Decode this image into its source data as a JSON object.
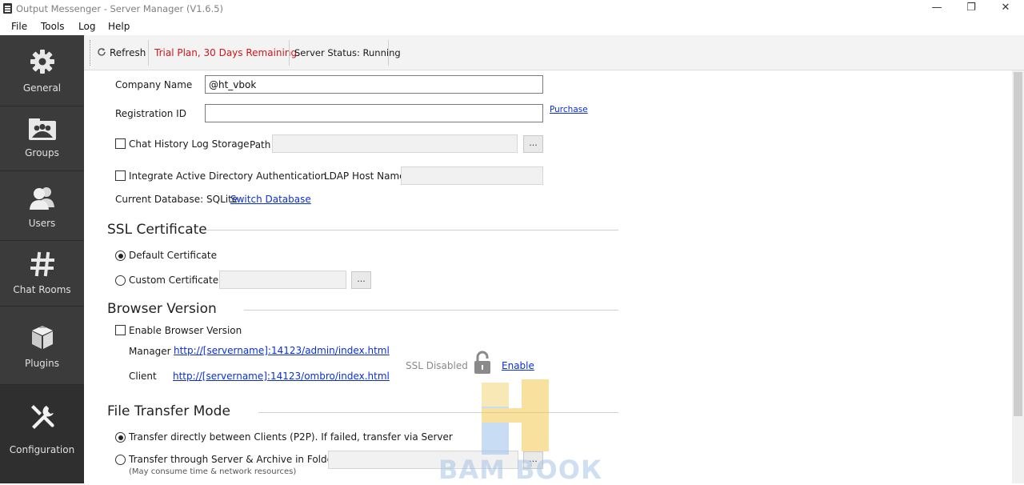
{
  "window": {
    "title": "Output Messenger - Server Manager  (V1.6.5)",
    "minimize": "—",
    "restore": "❐",
    "close": "✕"
  },
  "menu": [
    "File",
    "Tools",
    "Log",
    "Help"
  ],
  "sidebar": {
    "items": [
      {
        "label": "General",
        "icon": "gear-icon"
      },
      {
        "label": "Groups",
        "icon": "groups-icon"
      },
      {
        "label": "Users",
        "icon": "users-icon"
      },
      {
        "label": "Chat Rooms",
        "icon": "hash-icon"
      },
      {
        "label": "Plugins",
        "icon": "plugins-icon"
      },
      {
        "label": "Configuration",
        "icon": "tools-icon"
      }
    ],
    "active": "Configuration"
  },
  "toolbar": {
    "refresh_label": "Refresh",
    "trial_text": "Trial Plan, 30 Days Remaining.",
    "status_text": "Server Status: Running"
  },
  "general": {
    "company_label": "Company Name",
    "company_value": "@ht_vbok",
    "registration_label": "Registration ID",
    "registration_value": "",
    "purchase_link": "Purchase",
    "chat_history_label": "Chat History Log Storage",
    "path_label": "Path",
    "path_value": "",
    "browse_label": "...",
    "ad_label": "Integrate Active Directory Authentication",
    "ldap_label": "LDAP Host Name",
    "ldap_value": "",
    "db_label": "Current Database: SQLite",
    "switch_db_link": "Switch Database"
  },
  "ssl": {
    "title": "SSL Certificate",
    "default_label": "Default Certificate",
    "custom_label": "Custom Certificate",
    "custom_value": "",
    "browse_label": "..."
  },
  "browser": {
    "title": "Browser Version",
    "enable_label": "Enable Browser Version",
    "manager_label": "Manager",
    "manager_link": "http://[servername]:14123/admin/index.html",
    "client_label": "Client",
    "client_link": "http://[servername]:14123/ombro/index.html",
    "ssl_disabled_label": "SSL Disabled",
    "enable_link": "Enable"
  },
  "file_transfer": {
    "title": "File Transfer Mode",
    "p2p_label": "Transfer directly between Clients (P2P).  If failed, transfer via Server",
    "server_label": "Transfer through Server & Archive in Folder",
    "server_note": "(May consume time & network resources)",
    "folder_value": "",
    "browse_label": "..."
  },
  "watermark": {
    "text": "ВАМ ВООК"
  },
  "colors": {
    "sidebar_bg": "#3b3b3b",
    "trial_red": "#d0161b",
    "link_blue": "#0b2fd6"
  }
}
